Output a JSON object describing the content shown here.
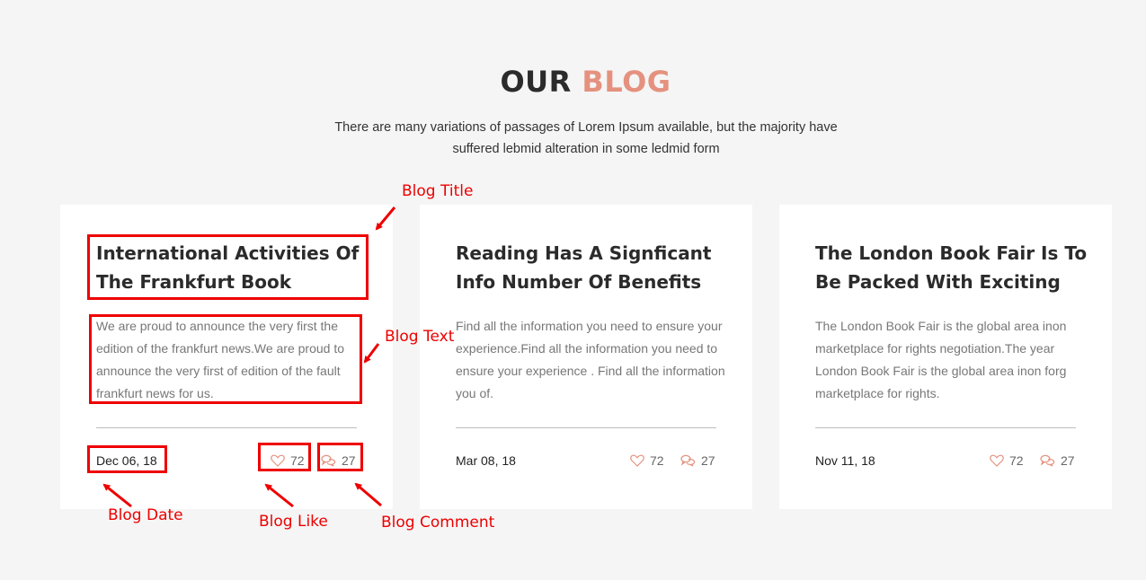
{
  "section": {
    "heading_word1": "OUR",
    "heading_word2": "BLOG",
    "subtitle_line1": "There are many variations of passages of Lorem Ipsum available, but the majority have",
    "subtitle_line2": "suffered lebmid alteration in some ledmid form"
  },
  "colors": {
    "accent": "#e4927f",
    "annotation": "#e00000",
    "card_bg": "#ffffff",
    "page_bg": "#f5f5f5"
  },
  "posts": [
    {
      "title": "International Activities Of The Frankfurt Book",
      "text": "We are proud to announce the very first the edition of the frankfurt news.We are proud to announce the very first of edition of the fault frankfurt news for us.",
      "date": "Dec 06, 18",
      "likes": "72",
      "comments": "27"
    },
    {
      "title": "Reading Has A Signficant Info Number Of Benefits",
      "text": "Find all the information you need to ensure your experience.Find all the information you need to ensure your experience . Find all the information you of.",
      "date": "Mar 08, 18",
      "likes": "72",
      "comments": "27"
    },
    {
      "title": "The London Book Fair Is To Be Packed With Exciting",
      "text": "The London Book Fair is the global area inon marketplace for rights negotiation.The year London Book Fair is the global area inon forg marketplace for rights.",
      "date": "Nov 11, 18",
      "likes": "72",
      "comments": "27"
    }
  ],
  "icons": {
    "like": "heart-icon",
    "comment": "comment-bubbles-icon"
  },
  "annotations": {
    "title": "Blog Title",
    "text": "Blog Text",
    "date": "Blog Date",
    "like": "Blog Like",
    "comment": "Blog Comment"
  }
}
